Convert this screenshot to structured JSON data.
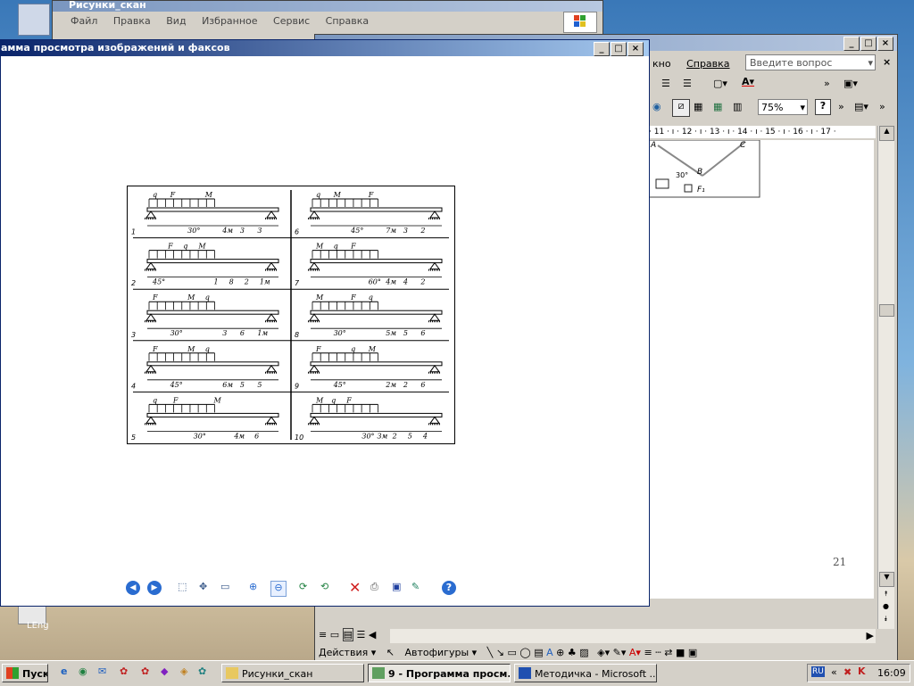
{
  "colors": {
    "titlebar_active": "#0a246a",
    "titlebar_inactive": "#7a96bf",
    "face": "#d4d0c8"
  },
  "back_window": {
    "title": "Рисунки_скан",
    "menu": [
      "Файл",
      "Правка",
      "Вид",
      "Избранное",
      "Сервис",
      "Справка"
    ]
  },
  "word_window": {
    "menu_partial": "кно",
    "menu_help": "Справка",
    "question_placeholder": "Введите вопрос",
    "zoom": "75%",
    "ruler": "· 11 · ı · 12 · ı · 13 · ı · 14 · ı · 15 · ı · 16 · ı · 17 ·",
    "page_number": "21",
    "bottom_actions": "Действия",
    "bottom_autoshapes": "Автофигуры",
    "drawing_labels": [
      "A",
      "B",
      "C",
      "30°",
      "F₁"
    ]
  },
  "viewer": {
    "title": "амма просмотра изображений и факсов",
    "buttons": [
      "prev",
      "next",
      "best-fit",
      "actual-size",
      "slideshow",
      "zoom-in",
      "zoom-out",
      "rotate-cw",
      "rotate-ccw",
      "delete",
      "print",
      "save",
      "edit",
      "help"
    ]
  },
  "beams": [
    {
      "n": "1",
      "labels": [
        "q",
        "F",
        "30°",
        "M",
        "4м",
        "3",
        "3"
      ]
    },
    {
      "n": "6",
      "labels": [
        "q",
        "M",
        "45°",
        "F",
        "7м",
        "3",
        "2"
      ]
    },
    {
      "n": "2",
      "labels": [
        "45°",
        "F",
        "q",
        "M",
        "1",
        "8",
        "2",
        "1м"
      ]
    },
    {
      "n": "7",
      "labels": [
        "M",
        "q",
        "F",
        "60°",
        "4м",
        "4",
        "2"
      ]
    },
    {
      "n": "3",
      "labels": [
        "F",
        "30°",
        "M",
        "q",
        "3",
        "6",
        "1м"
      ]
    },
    {
      "n": "8",
      "labels": [
        "M",
        "30°",
        "F",
        "q",
        "5м",
        "5",
        "6"
      ]
    },
    {
      "n": "4",
      "labels": [
        "F",
        "45°",
        "M",
        "q",
        "6м",
        "5",
        "5"
      ]
    },
    {
      "n": "9",
      "labels": [
        "F",
        "45°",
        "q",
        "M",
        "2м",
        "2",
        "6"
      ]
    },
    {
      "n": "5",
      "labels": [
        "q",
        "F",
        "30°",
        "M",
        "4м",
        "6"
      ]
    },
    {
      "n": "10",
      "labels": [
        "M",
        "q",
        "F",
        "30°",
        "3м",
        "2",
        "5",
        "4"
      ]
    }
  ],
  "desktop_icon": "LEng",
  "taskbar": {
    "start": "Пуск",
    "tasks": [
      "Рисунки_скан",
      "9 - Программа просм...",
      "Методичка - Microsoft ..."
    ],
    "lang": "RU",
    "clock": "16:09"
  }
}
